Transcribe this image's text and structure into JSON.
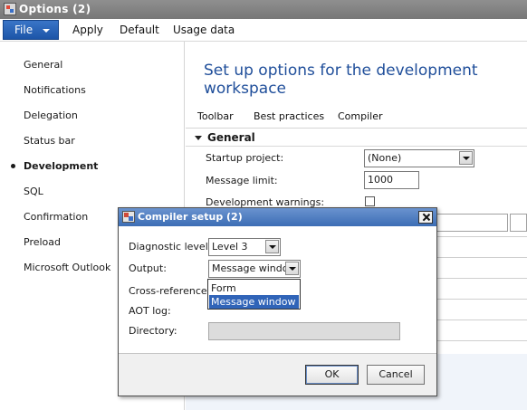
{
  "window": {
    "title": "Options (2)"
  },
  "menubar": {
    "file_label": "File",
    "items": [
      "Apply",
      "Default",
      "Usage data"
    ]
  },
  "sidebar": {
    "items": [
      {
        "label": "General"
      },
      {
        "label": "Notifications"
      },
      {
        "label": "Delegation"
      },
      {
        "label": "Status bar"
      },
      {
        "label": "Development",
        "active": true
      },
      {
        "label": "SQL"
      },
      {
        "label": "Confirmation"
      },
      {
        "label": "Preload"
      },
      {
        "label": "Microsoft Outlook"
      }
    ]
  },
  "main": {
    "heading": "Set up options for the development workspace",
    "tabs": [
      "Toolbar",
      "Best practices",
      "Compiler"
    ],
    "section": "General",
    "fields": {
      "startup_label": "Startup project:",
      "startup_value": "(None)",
      "message_limit_label": "Message limit:",
      "message_limit_value": "1000",
      "dev_warnings_label": "Development warnings:",
      "dev_warnings_checked": false
    }
  },
  "dialog": {
    "title": "Compiler setup (2)",
    "diagnostic_label": "Diagnostic level:",
    "diagnostic_value": "Level 3",
    "output_label": "Output:",
    "output_value": "Message window",
    "crossref_label": "Cross-reference:",
    "aotlog_label": "AOT log:",
    "directory_label": "Directory:",
    "ok_label": "OK",
    "cancel_label": "Cancel"
  },
  "output_dropdown": {
    "options": [
      "Form",
      "Message window"
    ],
    "selected_index": 1
  },
  "colors": {
    "accent": "#1f4e9a",
    "file_button": "#1c55a8",
    "dialog_title": "#3c6db5",
    "selection": "#3064b8"
  }
}
